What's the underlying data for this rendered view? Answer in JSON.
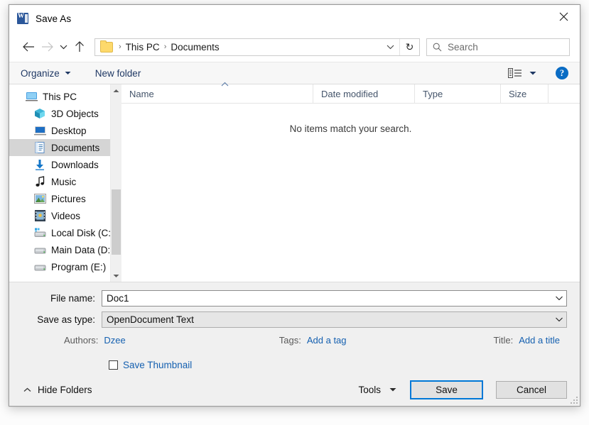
{
  "window": {
    "title": "Save As",
    "app_icon": "word-icon",
    "close_label": "✕"
  },
  "navbar": {
    "back_icon": "back-arrow-icon",
    "forward_icon": "forward-arrow-icon",
    "recent_icon": "recent-locations-chevron-icon",
    "up_icon": "up-arrow-icon",
    "breadcrumbs": [
      "This PC",
      "Documents"
    ],
    "separator": "›",
    "dropdown_icon": "chevron-down-icon",
    "refresh_icon": "refresh-icon",
    "refresh_glyph": "↻"
  },
  "search": {
    "placeholder": "Search",
    "icon": "search-icon"
  },
  "commandbar": {
    "organize_label": "Organize",
    "new_folder_label": "New folder",
    "view_icon": "view-layout-icon",
    "help_label": "?",
    "help_icon": "help-icon"
  },
  "sidebar": {
    "items": [
      {
        "label": "This PC",
        "icon": "computer-icon",
        "indent": false,
        "selected": false
      },
      {
        "label": "3D Objects",
        "icon": "3d-objects-icon",
        "indent": true,
        "selected": false
      },
      {
        "label": "Desktop",
        "icon": "desktop-icon",
        "indent": true,
        "selected": false
      },
      {
        "label": "Documents",
        "icon": "documents-icon",
        "indent": true,
        "selected": true
      },
      {
        "label": "Downloads",
        "icon": "downloads-icon",
        "indent": true,
        "selected": false
      },
      {
        "label": "Music",
        "icon": "music-icon",
        "indent": true,
        "selected": false
      },
      {
        "label": "Pictures",
        "icon": "pictures-icon",
        "indent": true,
        "selected": false
      },
      {
        "label": "Videos",
        "icon": "videos-icon",
        "indent": true,
        "selected": false
      },
      {
        "label": "Local Disk (C:)",
        "icon": "local-disk-icon",
        "indent": true,
        "selected": false
      },
      {
        "label": "Main Data (D:)",
        "icon": "drive-icon",
        "indent": true,
        "selected": false
      },
      {
        "label": "Program (E:)",
        "icon": "drive-icon",
        "indent": true,
        "selected": false
      }
    ]
  },
  "filelist": {
    "columns": [
      "Name",
      "Date modified",
      "Type",
      "Size"
    ],
    "sorted_column": "Name",
    "sort_direction": "ascending",
    "rows": [],
    "empty_message": "No items match your search."
  },
  "form": {
    "filename_label": "File name:",
    "filename_value": "Doc1",
    "savetype_label": "Save as type:",
    "savetype_value": "OpenDocument Text",
    "authors_label": "Authors:",
    "authors_value": "Dzee",
    "tags_label": "Tags:",
    "tags_value": "Add a tag",
    "title_label": "Title:",
    "title_value": "Add a title",
    "thumbnail_label": "Save Thumbnail",
    "thumbnail_checked": false
  },
  "footer": {
    "hide_folders_label": "Hide Folders",
    "tools_label": "Tools",
    "save_label": "Save",
    "cancel_label": "Cancel"
  },
  "colors": {
    "accent": "#0078d7",
    "link": "#1560b0",
    "header_text": "#44546a",
    "command_text": "#1f3864",
    "selection": "#d5d5d5",
    "word_blue": "#2b579a",
    "folder_yellow": "#fdd96b"
  }
}
